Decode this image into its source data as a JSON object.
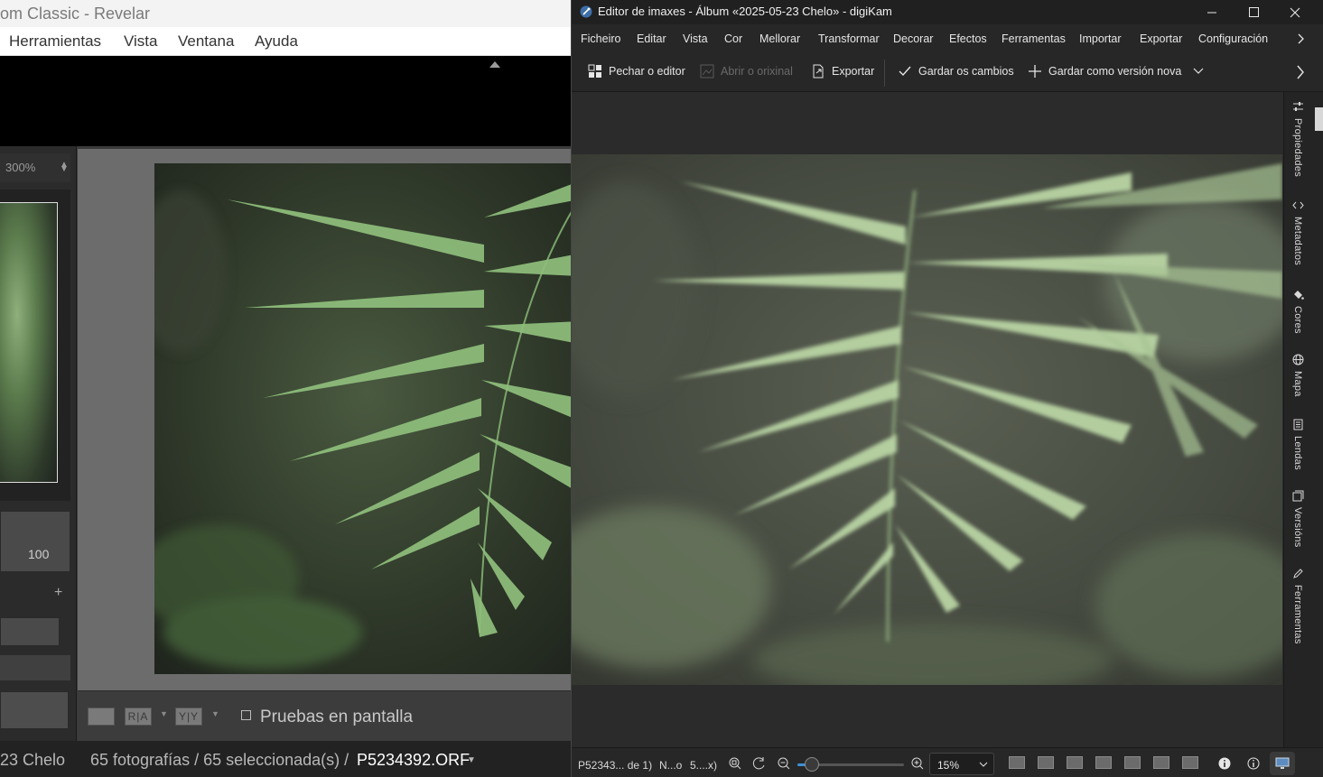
{
  "lightroom": {
    "title": "om Classic - Revelar",
    "menu": [
      "Herramientas",
      "Vista",
      "Ventana",
      "Ayuda"
    ],
    "zoom": "300%",
    "histogram_value": "100",
    "proof_label": "Pruebas en pantalla",
    "toolbar_icons": {
      "compare_ra": "R|A",
      "compare_yy": "Y|Y"
    },
    "status": {
      "folder": "23 Chelo",
      "counts": "65 fotografías / 65 seleccionada(s) /",
      "filename": "P5234392.ORF"
    }
  },
  "digikam": {
    "title": "Editor de imaxes - Álbum «2025-05-23 Chelo» - digiKam",
    "menu": [
      "Ficheiro",
      "Editar",
      "Vista",
      "Cor",
      "Mellorar",
      "Transformar",
      "Decorar",
      "Efectos",
      "Ferramentas",
      "Importar",
      "Exportar",
      "Configuración"
    ],
    "toolbar": {
      "close_editor": "Pechar o editor",
      "open_original": "Abrir o orixinal",
      "export": "Exportar",
      "save_changes": "Gardar os cambios",
      "save_new_version": "Gardar como versión nova"
    },
    "side_tabs": [
      "Propiedades",
      "Metadatos",
      "Cores",
      "Mapa",
      "Lendas",
      "Versións",
      "Ferramentas"
    ],
    "status": {
      "file": "P52343... de 1)",
      "info1": "N...o",
      "info2": "5....x)",
      "zoom": "15%"
    },
    "accent_color": "#3d8fd6"
  }
}
